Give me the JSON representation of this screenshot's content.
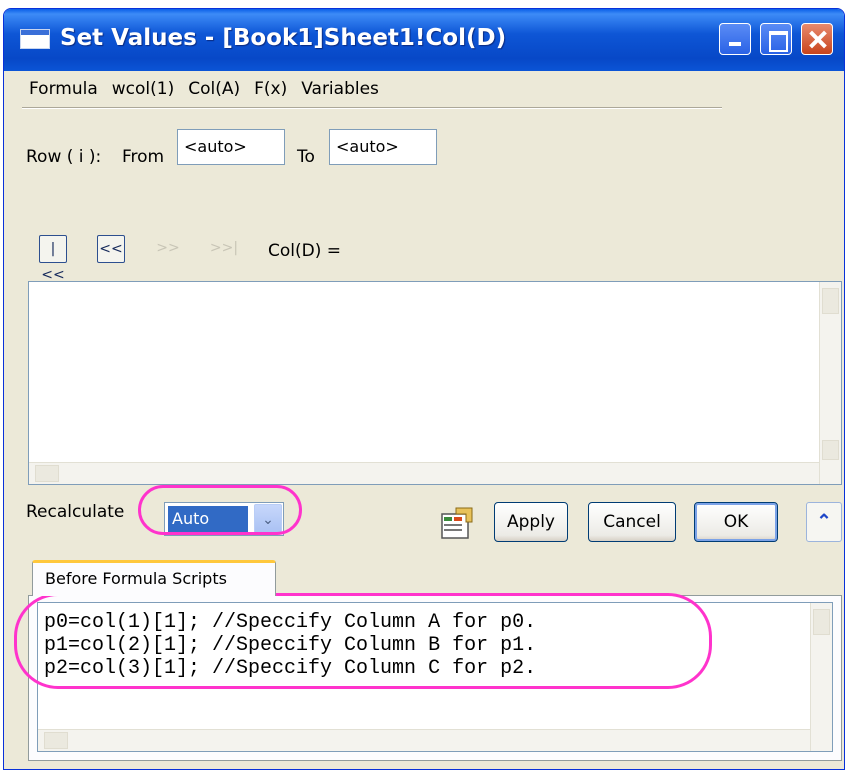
{
  "window": {
    "title": "Set Values - [Book1]Sheet1!Col(D)"
  },
  "menu": {
    "items": [
      "Formula",
      "wcol(1)",
      "Col(A)",
      "F(x)",
      "Variables"
    ]
  },
  "row": {
    "label": "Row ( i ):",
    "from_label": "From",
    "from_value": "<auto>",
    "to_label": "To",
    "to_value": "<auto>"
  },
  "nav": {
    "first": "|<<",
    "prev": "<<",
    "next": ">>",
    "last": ">>|",
    "col_label": "Col(D) ="
  },
  "formula": {
    "value": ""
  },
  "recalculate": {
    "label": "Recalculate",
    "selected": "Auto"
  },
  "buttons": {
    "apply": "Apply",
    "cancel": "Cancel",
    "ok": "OK",
    "expand_icon": "double-chevron-up-icon"
  },
  "tabs": {
    "before_formula": "Before Formula Scripts"
  },
  "script": {
    "lines": [
      "p0=col(1)[1]; //Speccify Column A for p0.",
      "p1=col(2)[1]; //Speccify Column B for p1.",
      "p2=col(3)[1]; //Speccify Column C for p2."
    ]
  },
  "colors": {
    "titlebar": "#0a5fe8",
    "highlight": "#ff33cc",
    "selection": "#316ac5"
  }
}
